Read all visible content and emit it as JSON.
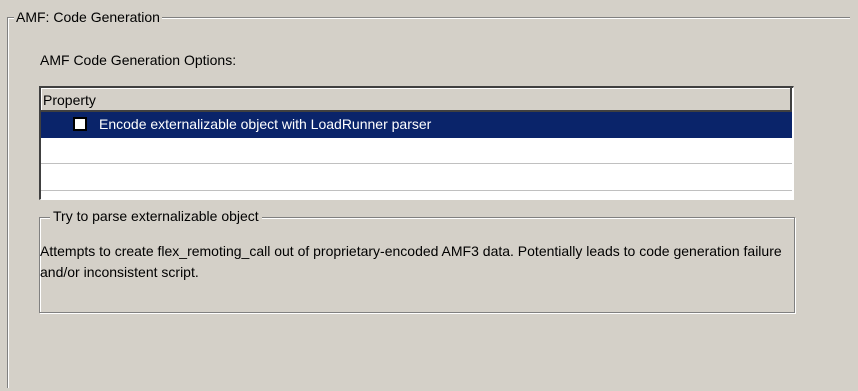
{
  "group": {
    "title": "AMF: Code Generation",
    "options_label": "AMF Code Generation Options:"
  },
  "property_list": {
    "column_header": "Property",
    "rows": [
      {
        "label": "Encode externalizable object with LoadRunner parser",
        "checked": false,
        "selected": true
      }
    ]
  },
  "description": {
    "title": "Try to parse externalizable object",
    "text": "Attempts to create flex_remoting_call out of proprietary-encoded AMF3 data. Potentially leads to code generation failure and/or inconsistent script."
  },
  "colors": {
    "background": "#d4d0c8",
    "selection": "#0a246a",
    "selection_text": "#ffffff"
  }
}
